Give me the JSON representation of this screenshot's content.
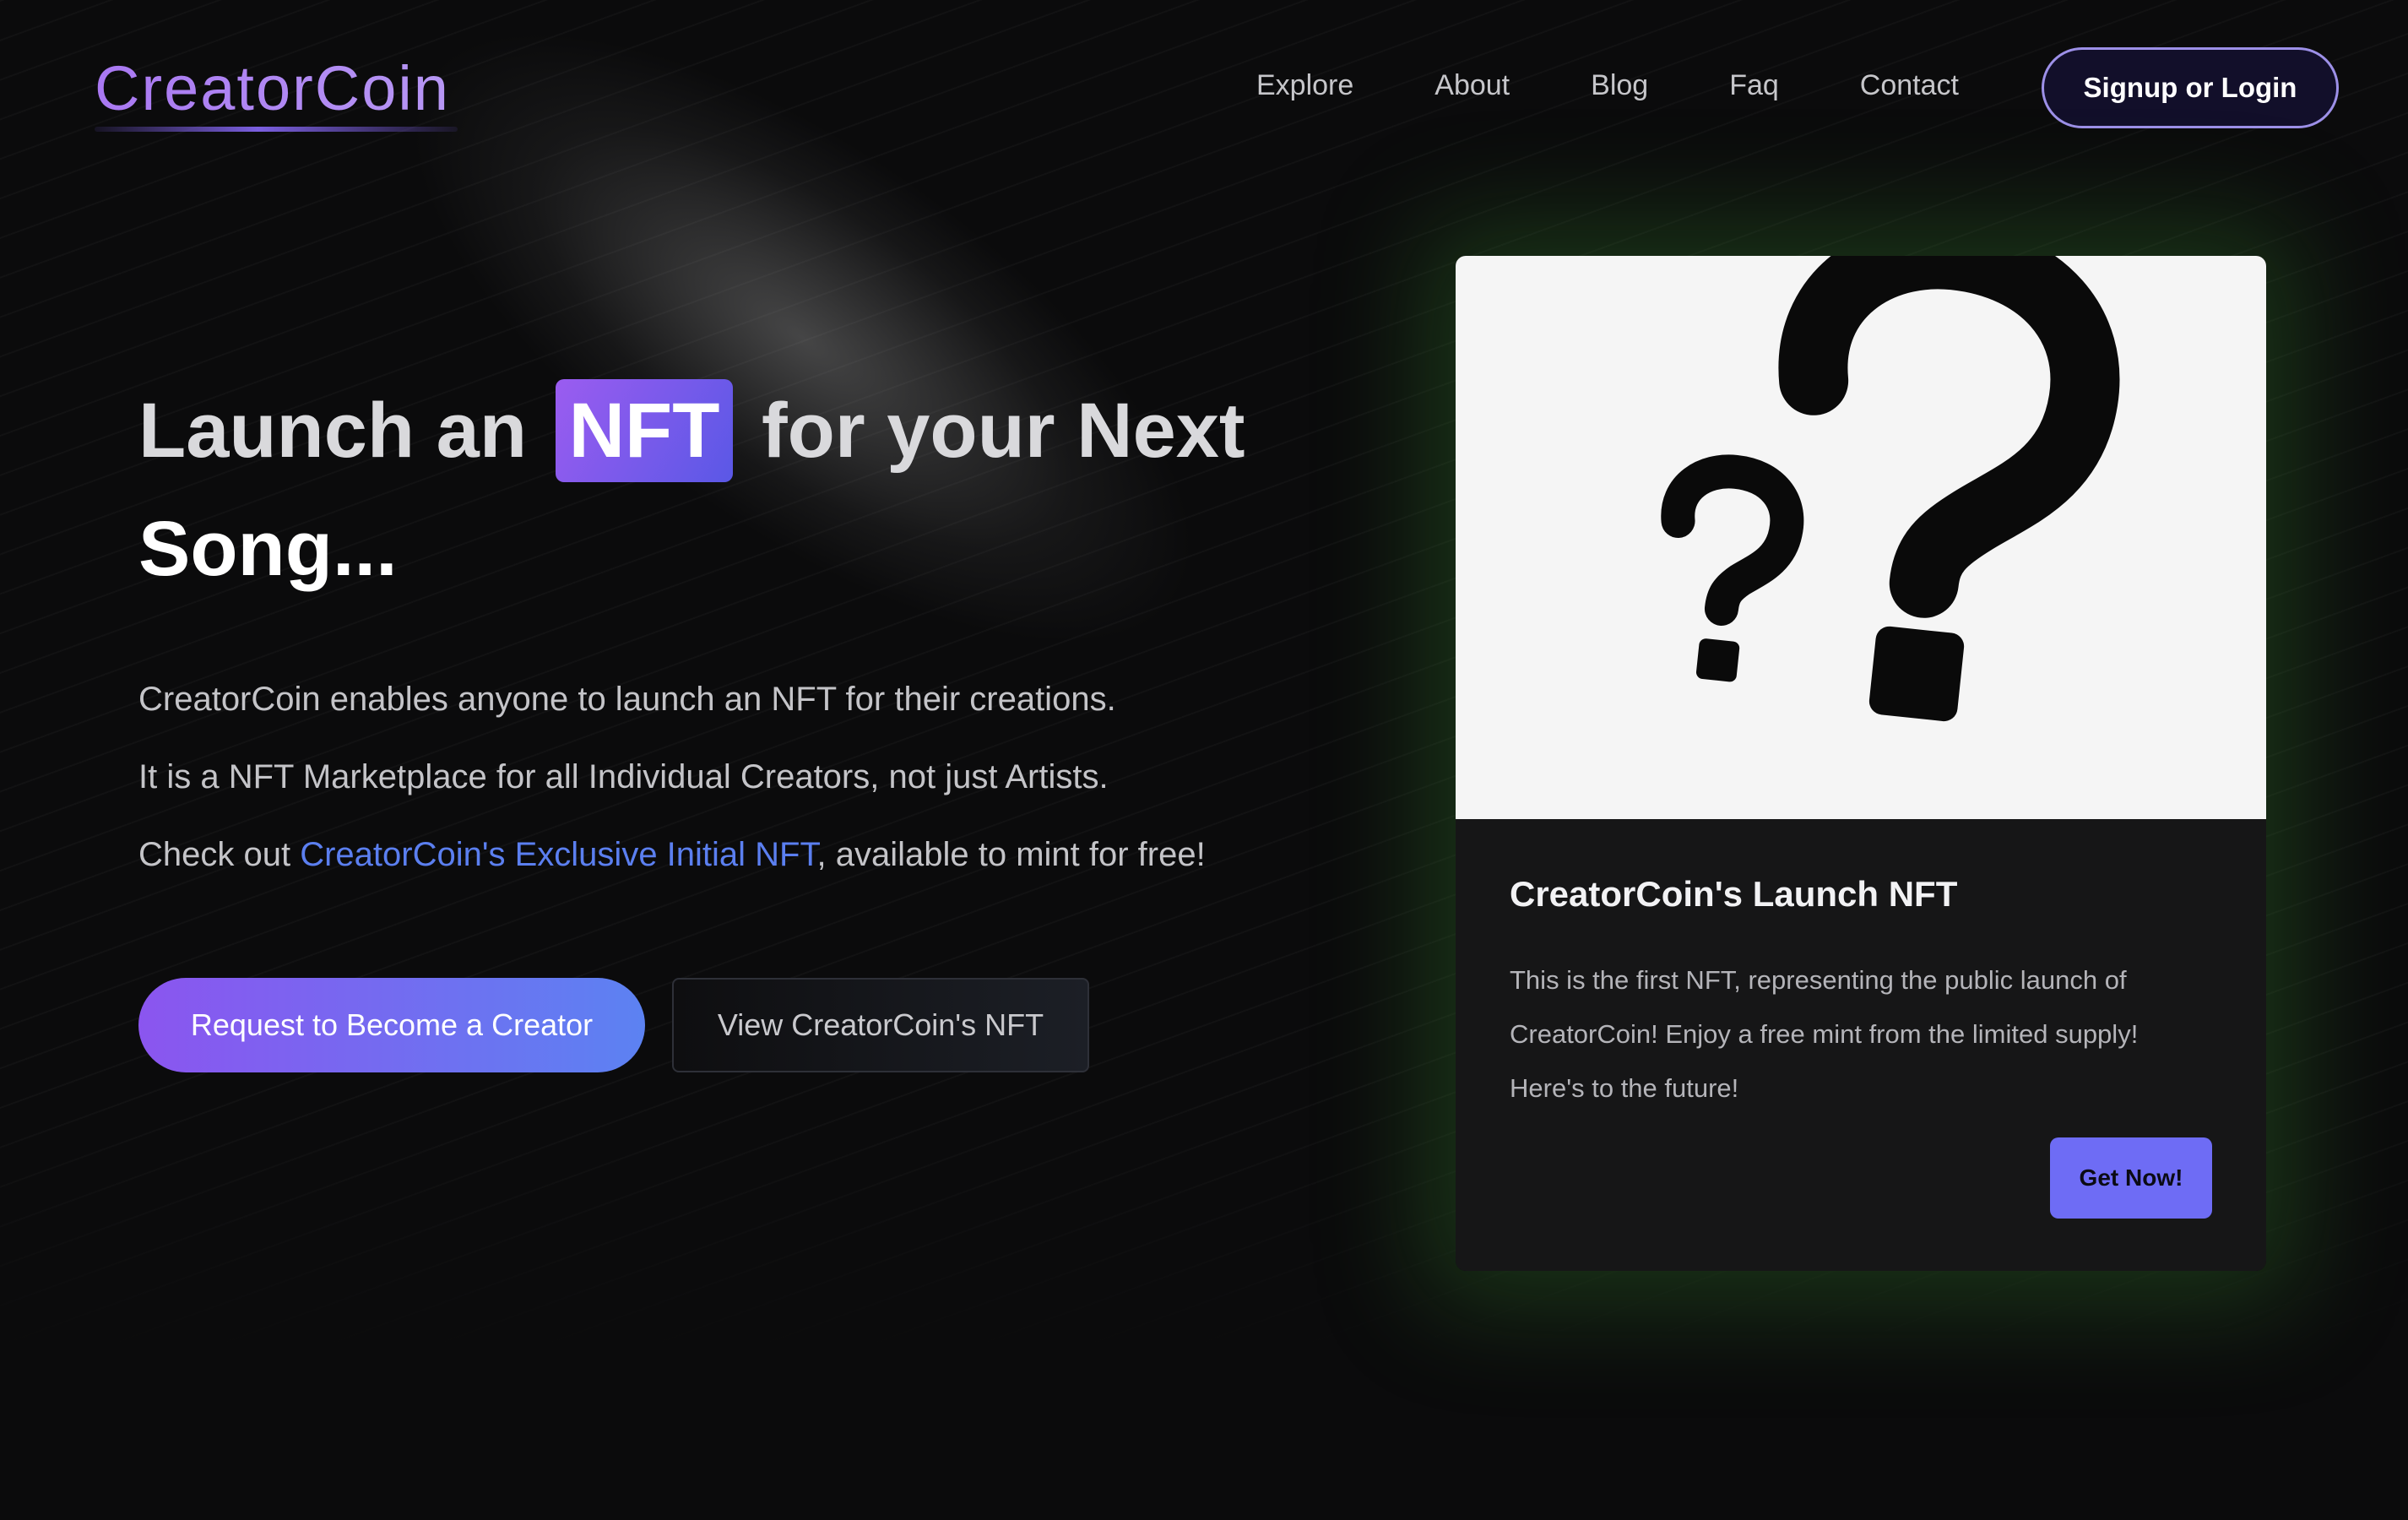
{
  "brand": {
    "name": "CreatorCoin",
    "logo_color": "#a978f2"
  },
  "nav": {
    "items": [
      {
        "label": "Explore"
      },
      {
        "label": "About"
      },
      {
        "label": "Blog"
      },
      {
        "label": "Faq"
      },
      {
        "label": "Contact"
      }
    ],
    "signup_label": "Signup or Login"
  },
  "hero": {
    "headline_pre": "Launch an",
    "headline_highlight": "NFT",
    "headline_post": "for your Next",
    "headline_line2": "Song...",
    "para1": "CreatorCoin enables anyone to launch an NFT for their creations.",
    "para2": "It is a NFT Marketplace for all Individual Creators, not just Artists.",
    "para3_pre": "Check out ",
    "para3_link": "CreatorCoin's Exclusive Initial NFT",
    "para3_post": ", available to mint for free!",
    "primary_button": "Request to Become a Creator",
    "secondary_button": "View CreatorCoin's NFT"
  },
  "card": {
    "image_icon": "question-marks-icon",
    "title": "CreatorCoin's Launch NFT",
    "description": "This is the first NFT, representing the public launch of CreatorCoin! Enjoy a free mint from the limited supply! Here's to the future!",
    "button": "Get Now!",
    "glow_color": "#3c8c32",
    "button_color": "#6e6cf5"
  }
}
